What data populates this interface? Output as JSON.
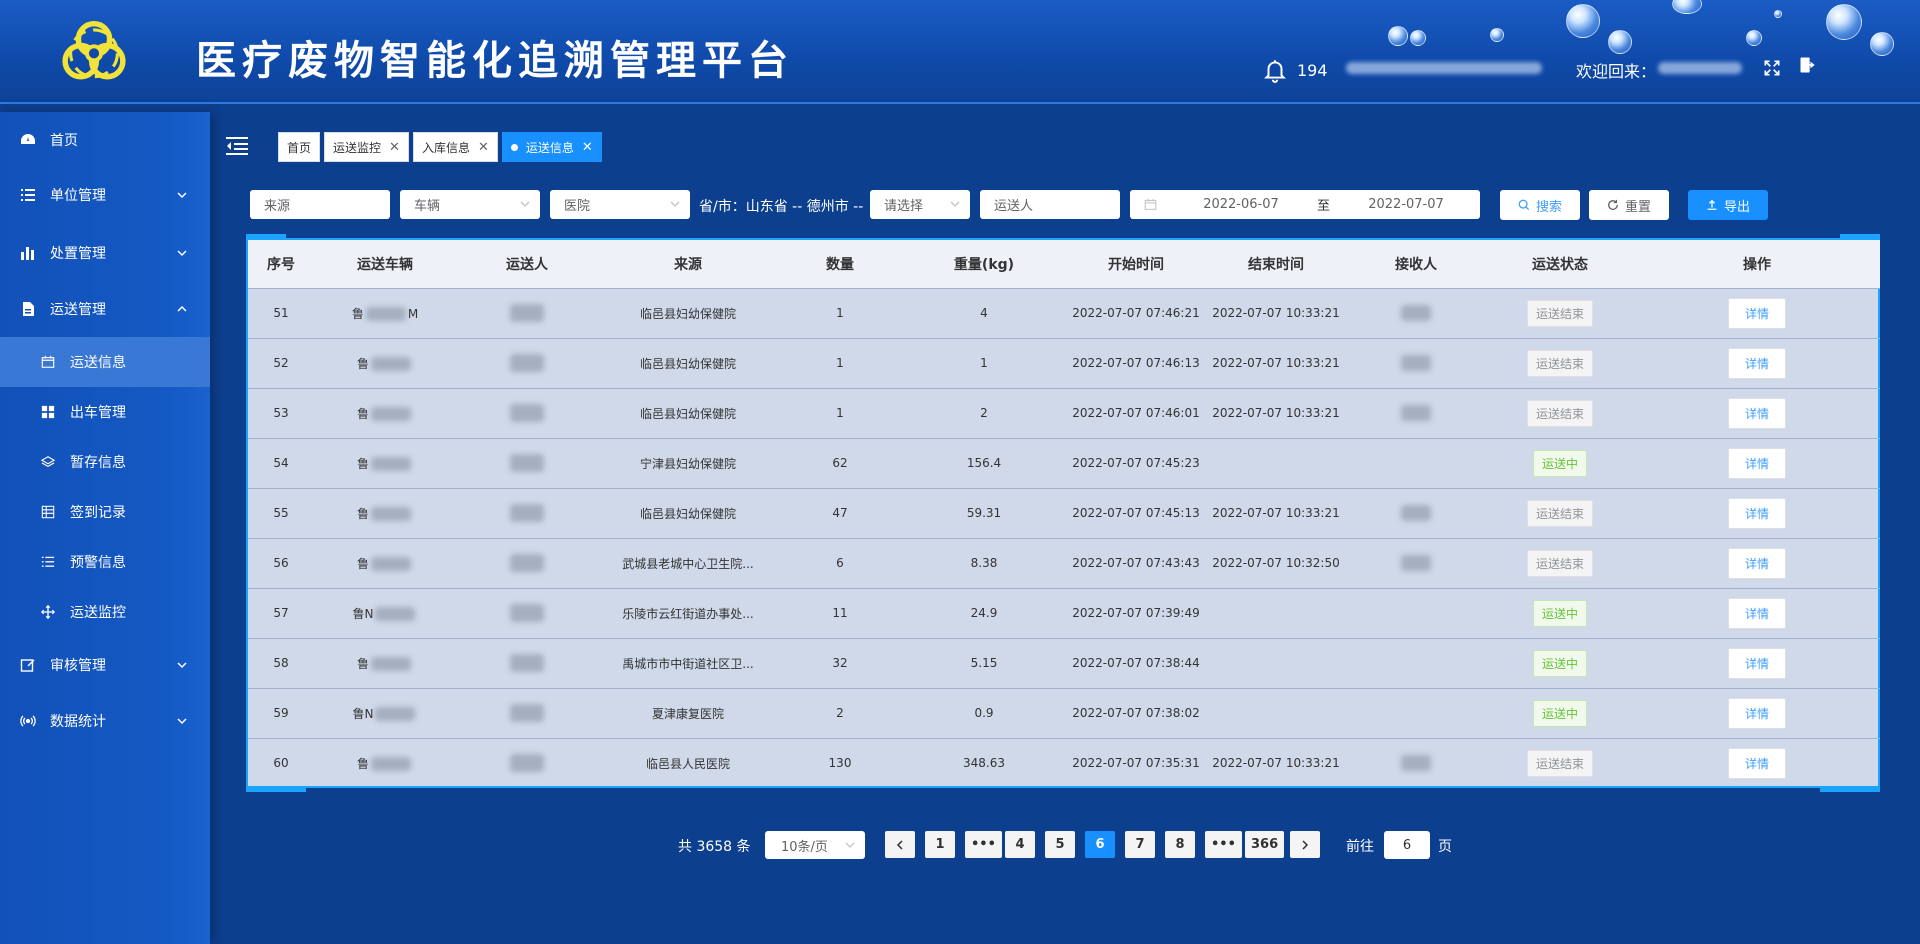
{
  "app": {
    "title": "医疗废物智能化追溯管理平台",
    "notification_count": "194",
    "welcome_label": "欢迎回来："
  },
  "sidebar": {
    "items": [
      {
        "label": "首页",
        "icon": "dashboard-icon",
        "expandable": false
      },
      {
        "label": "单位管理",
        "icon": "list-icon",
        "expandable": true
      },
      {
        "label": "处置管理",
        "icon": "bar-chart-icon",
        "expandable": true
      },
      {
        "label": "运送管理",
        "icon": "document-icon",
        "expandable": true,
        "expanded": true
      },
      {
        "label": "运送信息",
        "icon": "calendar-icon",
        "sub": true,
        "active": true
      },
      {
        "label": "出车管理",
        "icon": "grid-icon",
        "sub": true
      },
      {
        "label": "暂存信息",
        "icon": "layers-icon",
        "sub": true
      },
      {
        "label": "签到记录",
        "icon": "table-icon",
        "sub": true
      },
      {
        "label": "预警信息",
        "icon": "checklist-icon",
        "sub": true
      },
      {
        "label": "运送监控",
        "icon": "move-icon",
        "sub": true
      },
      {
        "label": "审核管理",
        "icon": "edit-icon",
        "expandable": true
      },
      {
        "label": "数据统计",
        "icon": "signal-icon",
        "expandable": true
      }
    ]
  },
  "tabs": [
    {
      "label": "首页",
      "closable": false
    },
    {
      "label": "运送监控",
      "closable": true
    },
    {
      "label": "入库信息",
      "closable": true
    },
    {
      "label": "运送信息",
      "closable": true,
      "active": true
    }
  ],
  "filters": {
    "source_placeholder": "来源",
    "vehicle_placeholder": "车辆",
    "hospital_placeholder": "医院",
    "region_label": "省/市：山东省 -- 德州市 --",
    "district_placeholder": "请选择",
    "transporter_placeholder": "运送人",
    "date_start": "2022-06-07",
    "date_sep": "至",
    "date_end": "2022-07-07",
    "search_label": "搜索",
    "reset_label": "重置",
    "export_label": "导出"
  },
  "table": {
    "headers": [
      "序号",
      "运送车辆",
      "运送人",
      "来源",
      "数量",
      "重量(kg)",
      "开始时间",
      "结束时间",
      "接收人",
      "运送状态",
      "操作"
    ],
    "rows": [
      {
        "no": "51",
        "vehicle": "鲁",
        "vehicle_tail": "M",
        "source": "临邑县妇幼保健院",
        "qty": "1",
        "weight": "4",
        "start": "2022-07-07 07:46:21",
        "end": "2022-07-07 10:33:21",
        "status": "运送结束",
        "state": "done"
      },
      {
        "no": "52",
        "vehicle": "鲁",
        "vehicle_tail": "",
        "source": "临邑县妇幼保健院",
        "qty": "1",
        "weight": "1",
        "start": "2022-07-07 07:46:13",
        "end": "2022-07-07 10:33:21",
        "status": "运送结束",
        "state": "done"
      },
      {
        "no": "53",
        "vehicle": "鲁",
        "vehicle_tail": "",
        "source": "临邑县妇幼保健院",
        "qty": "1",
        "weight": "2",
        "start": "2022-07-07 07:46:01",
        "end": "2022-07-07 10:33:21",
        "status": "运送结束",
        "state": "done"
      },
      {
        "no": "54",
        "vehicle": "鲁",
        "vehicle_tail": "",
        "source": "宁津县妇幼保健院",
        "qty": "62",
        "weight": "156.4",
        "start": "2022-07-07 07:45:23",
        "end": "",
        "status": "运送中",
        "state": "ing"
      },
      {
        "no": "55",
        "vehicle": "鲁",
        "vehicle_tail": "",
        "source": "临邑县妇幼保健院",
        "qty": "47",
        "weight": "59.31",
        "start": "2022-07-07 07:45:13",
        "end": "2022-07-07 10:33:21",
        "status": "运送结束",
        "state": "done"
      },
      {
        "no": "56",
        "vehicle": "鲁",
        "vehicle_tail": "",
        "source": "武城县老城中心卫生院...",
        "qty": "6",
        "weight": "8.38",
        "start": "2022-07-07 07:43:43",
        "end": "2022-07-07 10:32:50",
        "status": "运送结束",
        "state": "done"
      },
      {
        "no": "57",
        "vehicle": "鲁N",
        "vehicle_tail": "",
        "source": "乐陵市云红街道办事处...",
        "qty": "11",
        "weight": "24.9",
        "start": "2022-07-07 07:39:49",
        "end": "",
        "status": "运送中",
        "state": "ing"
      },
      {
        "no": "58",
        "vehicle": "鲁",
        "vehicle_tail": "",
        "source": "禹城市市中街道社区卫...",
        "qty": "32",
        "weight": "5.15",
        "start": "2022-07-07 07:38:44",
        "end": "",
        "status": "运送中",
        "state": "ing"
      },
      {
        "no": "59",
        "vehicle": "鲁N",
        "vehicle_tail": "",
        "source": "夏津康复医院",
        "qty": "2",
        "weight": "0.9",
        "start": "2022-07-07 07:38:02",
        "end": "",
        "status": "运送中",
        "state": "ing"
      },
      {
        "no": "60",
        "vehicle": "鲁",
        "vehicle_tail": "",
        "source": "临邑县人民医院",
        "qty": "130",
        "weight": "348.63",
        "start": "2022-07-07 07:35:31",
        "end": "2022-07-07 10:33:21",
        "status": "运送结束",
        "state": "done"
      }
    ],
    "detail_label": "详情"
  },
  "pagination": {
    "total": "共 3658 条",
    "page_size": "10条/页",
    "pages": [
      "1",
      "•••",
      "4",
      "5",
      "6",
      "7",
      "8",
      "•••",
      "366"
    ],
    "current": "6",
    "goto_prefix": "前往",
    "goto_value": "6",
    "goto_suffix": "页"
  },
  "colors": {
    "header": "#1a5cc4",
    "sidebar": "#1251b8",
    "accent": "#1890ff",
    "table_border": "#1aa3ff",
    "logo": "#f2e33a"
  }
}
